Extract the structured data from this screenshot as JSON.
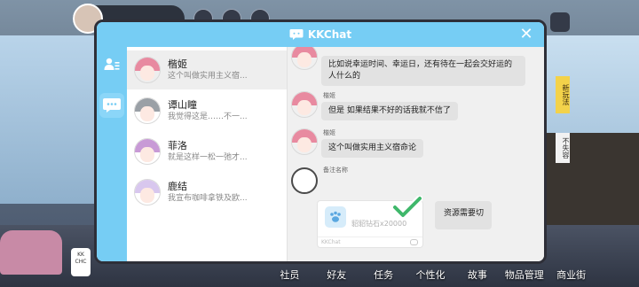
{
  "modal": {
    "title": "KKChat",
    "close_symbol": "✕"
  },
  "rail": {
    "contacts_icon": "person-list-icon",
    "chat_icon": "chat-bubble-icon"
  },
  "contacts": [
    {
      "name": "楷姬",
      "preview": "这个叫做实用主义宿...",
      "hair_color": "#e88aa0",
      "selected": true
    },
    {
      "name": "谭山瞳",
      "preview": "我觉得这是……不一...",
      "hair_color": "#9aa0a6",
      "selected": false
    },
    {
      "name": "菲洛",
      "preview": "就是这样一松一弛才...",
      "hair_color": "#c89ad6",
      "selected": false
    },
    {
      "name": "鹿结",
      "preview": "我宣布咖啡拿铁及欧...",
      "hair_color": "#d8c7ee",
      "selected": false
    }
  ],
  "chat": {
    "messages": [
      {
        "sender": "楷姬",
        "lines": [
          "比如说幸运时间、幸运日，还有待在一起会交好运的",
          "人什么的"
        ]
      },
      {
        "sender": "楷姬",
        "lines": [
          "但是 如果结果不好的话我就不信了"
        ]
      },
      {
        "sender": "楷姬",
        "lines": [
          "这个叫做实用主义宿命论"
        ]
      }
    ],
    "pending": {
      "name_label": "备注名称",
      "gift_text": "貂貂钻石x20000",
      "gift_footer": "KKChat",
      "resource_label": "资源需要切"
    }
  },
  "hud": {
    "kk_badge": "KK\nCHC",
    "side_tag_1": "新玩法",
    "side_tag_2": "不失容"
  },
  "bottom_nav": [
    "社员",
    "好友",
    "任务",
    "个性化",
    "故事",
    "物品管理",
    "商业街"
  ],
  "colors": {
    "header": "#76cdf4",
    "chat_bg": "#f0f0f0",
    "bubble": "#e2e2e2",
    "check": "#3fb86b"
  }
}
